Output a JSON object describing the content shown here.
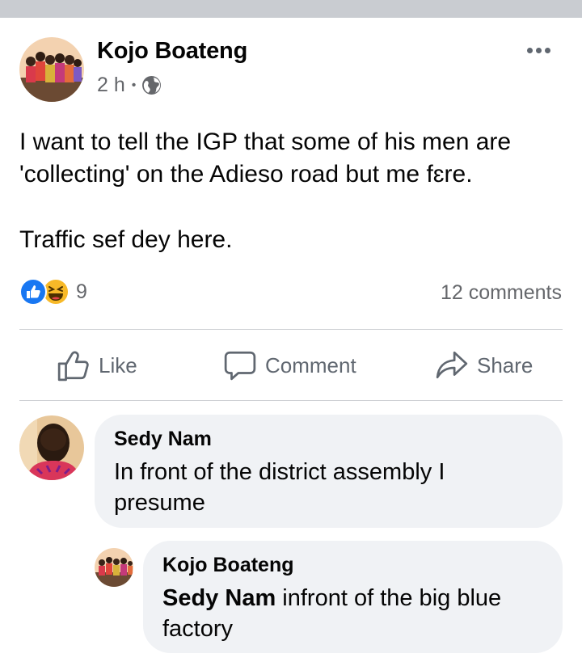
{
  "post": {
    "author": "Kojo Boateng",
    "time": "2 h",
    "separator": "•",
    "audience_icon": "globe-icon",
    "more_icon": "more-options-icon",
    "text_line_1": "I want to tell the IGP that some of his men are 'collecting' on the Adieso road but me fɛre.",
    "text_line_2": "Traffic sef dey here."
  },
  "engagement": {
    "reaction_icons": [
      "like-reaction-icon",
      "haha-reaction-icon"
    ],
    "reaction_count": "9",
    "comments_count": "12 comments"
  },
  "actions": {
    "like_label": "Like",
    "comment_label": "Comment",
    "share_label": "Share"
  },
  "comments": [
    {
      "author": "Sedy Nam",
      "text": "In front of the district assembly I presume"
    },
    {
      "author": "Kojo Boateng",
      "mention": "Sedy Nam",
      "text": " infront of the big blue factory"
    }
  ],
  "colors": {
    "like_blue": "#1877f2",
    "haha_yellow": "#f7b928",
    "secondary_text": "#65676b",
    "bubble_bg": "#f0f2f5"
  }
}
